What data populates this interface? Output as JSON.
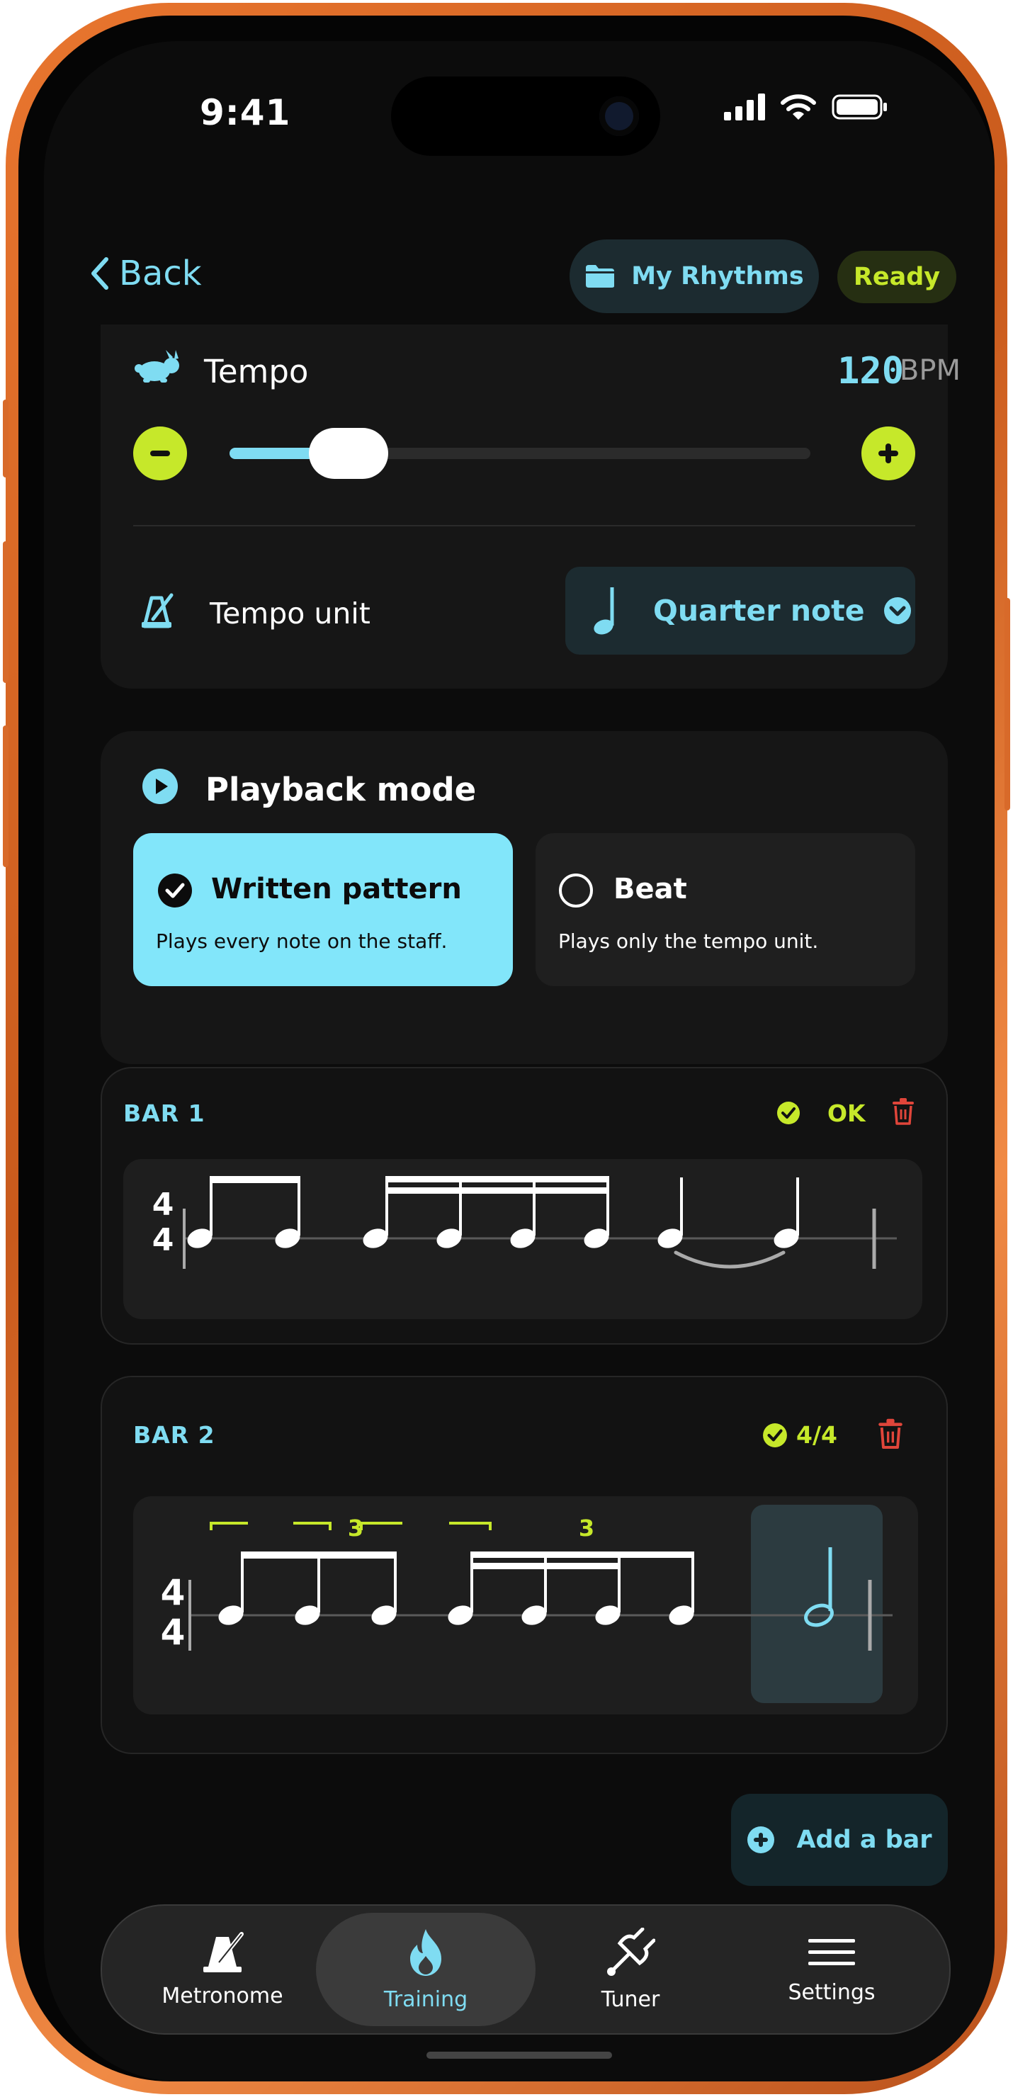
{
  "status": {
    "time": "9:41"
  },
  "header": {
    "back_label": "Back",
    "my_rhythms_label": "My Rhythms",
    "status_badge": "Ready"
  },
  "tempo": {
    "label": "Tempo",
    "value": "120",
    "unit": "BPM",
    "slider_fraction": 0.18,
    "tempo_unit_label": "Tempo unit",
    "tempo_unit_value": "Quarter note"
  },
  "playback": {
    "title": "Playback mode",
    "options": [
      {
        "title": "Written pattern",
        "desc": "Plays every note on the staff.",
        "selected": true
      },
      {
        "title": "Beat",
        "desc": "Plays only the tempo unit.",
        "selected": false
      }
    ]
  },
  "bars": [
    {
      "title": "BAR 1",
      "status": "OK",
      "time_sig_top": "4",
      "time_sig_bottom": "4"
    },
    {
      "title": "BAR 2",
      "status": "4/4",
      "time_sig_top": "4",
      "time_sig_bottom": "4",
      "tuplet_1": "3",
      "tuplet_2": "3"
    }
  ],
  "add_bar_label": "Add a bar",
  "tabs": [
    {
      "label": "Metronome",
      "icon": "metronome-icon"
    },
    {
      "label": "Training",
      "icon": "flame-icon",
      "active": true
    },
    {
      "label": "Tuner",
      "icon": "tuning-fork-icon"
    },
    {
      "label": "Settings",
      "icon": "menu-icon"
    }
  ],
  "colors": {
    "accent_cyan": "#7fdcf2",
    "accent_lime": "#c6e82a",
    "danger": "#e0453a",
    "frame_orange": "#e9762f"
  }
}
